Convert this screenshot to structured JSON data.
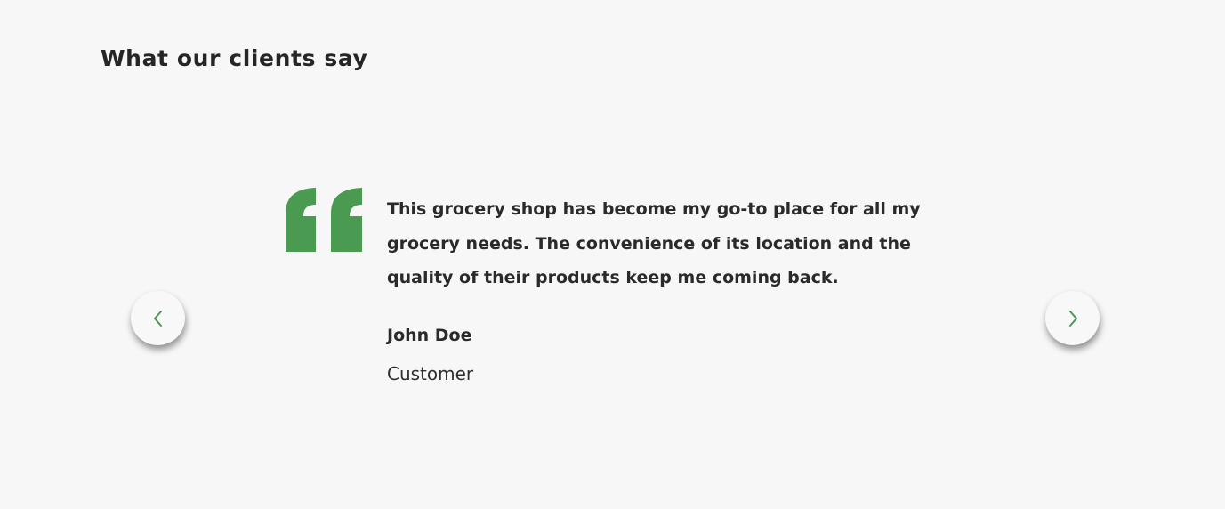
{
  "section": {
    "title": "What our clients say"
  },
  "carousel": {
    "prev_icon": "chevron-left-icon",
    "next_icon": "chevron-right-icon",
    "accent_color": "#4a9a52",
    "quote_icon": "quote-mark-icon"
  },
  "testimonial": {
    "text": "This grocery shop has become my go-to place for all my grocery needs. The convenience of its location and the quality of their products keep me coming back.",
    "author_name": "John Doe",
    "author_role": "Customer"
  }
}
